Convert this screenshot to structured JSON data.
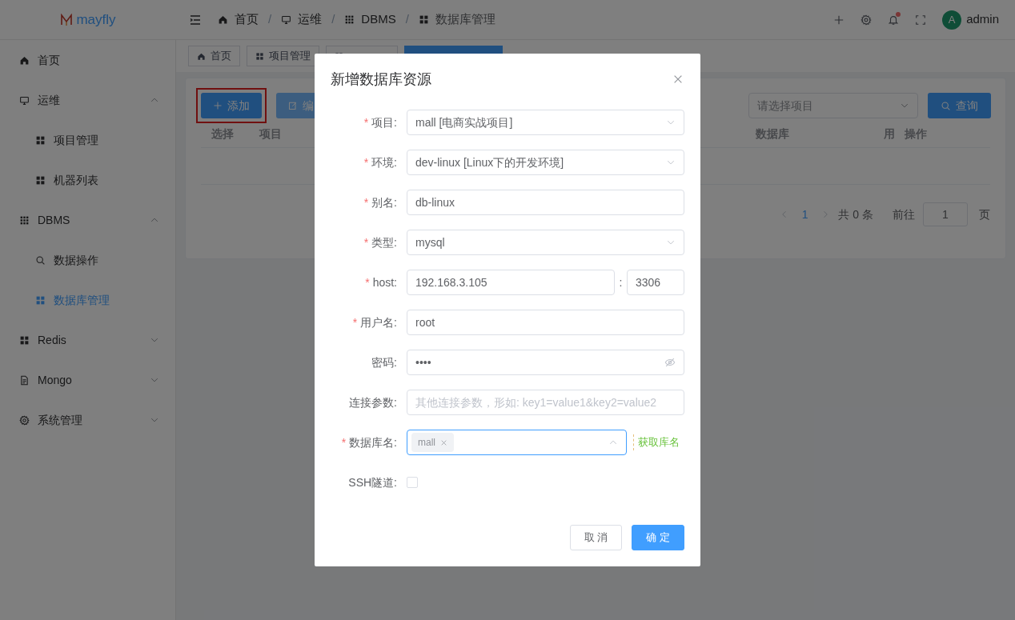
{
  "app": {
    "name": "mayfly"
  },
  "breadcrumb_separator": "/",
  "breadcrumb": [
    {
      "label": "首页"
    },
    {
      "label": "运维"
    },
    {
      "label": "DBMS"
    },
    {
      "label": "数据库管理"
    }
  ],
  "user": {
    "avatar": "A",
    "name": "admin",
    "notification": true
  },
  "sidebar": {
    "items": [
      {
        "label": "首页",
        "selected": false
      },
      {
        "label": "运维",
        "selected": false,
        "expanded": true,
        "children": [
          {
            "label": "项目管理",
            "selected": false
          },
          {
            "label": "机器列表",
            "selected": false
          }
        ]
      },
      {
        "label": "DBMS",
        "selected": false,
        "expanded": true,
        "children": [
          {
            "label": "数据操作",
            "selected": false
          },
          {
            "label": "数据库管理",
            "selected": true
          }
        ]
      },
      {
        "label": "Redis",
        "selected": false,
        "expanded": false
      },
      {
        "label": "Mongo",
        "selected": false,
        "expanded": false
      },
      {
        "label": "系统管理",
        "selected": false,
        "expanded": false
      }
    ]
  },
  "tabs": [
    {
      "label": "首页",
      "selected": false
    },
    {
      "label": "项目管理",
      "selected": false
    },
    {
      "selected": false
    },
    {
      "selected": true
    }
  ],
  "toolbar": {
    "add_button": {
      "label": "添加",
      "highlighted": true
    },
    "edit_button": {
      "label": "编"
    },
    "project_select": {
      "placeholder": "请选择项目"
    },
    "query_button": {
      "label": "查询"
    }
  },
  "table": {
    "columns": [
      "选择",
      "项目",
      "数据库",
      "用",
      "操作"
    ]
  },
  "pagination": {
    "current": "1",
    "total": "共 0 条",
    "goto": "前往",
    "page": "1",
    "suffix": "页"
  },
  "dialog": {
    "title": "新增数据库资源",
    "required_mark": "*",
    "fields": [
      {
        "kind": "select",
        "label": "项目:",
        "required": true,
        "value": "mall [电商实战项目]"
      },
      {
        "kind": "select",
        "label": "环境:",
        "required": true,
        "value": "dev-linux [Linux下的开发环境]"
      },
      {
        "kind": "input",
        "label": "别名:",
        "required": true,
        "value": "db-linux"
      },
      {
        "kind": "select",
        "label": "类型:",
        "required": true,
        "value": "mysql"
      },
      {
        "kind": "host",
        "label": "host:",
        "required": true,
        "value": "192.168.3.105",
        "separator": ":",
        "port": "3306"
      },
      {
        "kind": "input",
        "label": "用户名:",
        "required": true,
        "value": "root"
      },
      {
        "kind": "password",
        "label": "密码:",
        "required": false,
        "value": "••••"
      },
      {
        "kind": "input",
        "label": "连接参数:",
        "required": false,
        "placeholder": "其他连接参数，形如: key1=value1&key2=value2"
      },
      {
        "kind": "tags",
        "label": "数据库名:",
        "required": true,
        "tags": [
          "mall"
        ],
        "link": "获取库名"
      },
      {
        "kind": "checkbox",
        "label": "SSH隧道:",
        "required": false,
        "checked": false
      }
    ],
    "buttons": [
      {
        "label": "取 消",
        "primary": false
      },
      {
        "label": "确 定",
        "primary": true
      }
    ]
  }
}
